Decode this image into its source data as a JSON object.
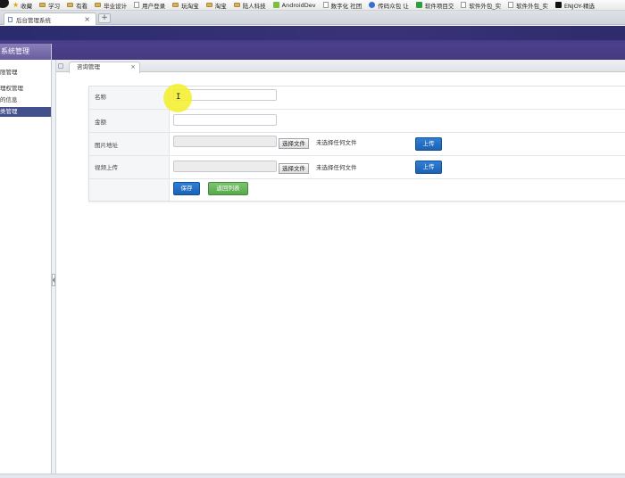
{
  "bookmarks": [
    {
      "label": "收藏",
      "icon": "star-icon"
    },
    {
      "label": "学习",
      "icon": "folder-icon"
    },
    {
      "label": "有看",
      "icon": "folder-icon"
    },
    {
      "label": "毕业设计",
      "icon": "folder-icon"
    },
    {
      "label": "用户登录",
      "icon": "doc-icon"
    },
    {
      "label": "玩淘宝",
      "icon": "folder-icon"
    },
    {
      "label": "淘宝",
      "icon": "folder-icon"
    },
    {
      "label": "陆人科技",
      "icon": "folder-icon"
    },
    {
      "label": "AndroidDev",
      "icon": "android-icon"
    },
    {
      "label": "数字化 社团",
      "icon": "doc-icon"
    },
    {
      "label": "传码众包 让",
      "icon": "circle-icon"
    },
    {
      "label": "软件项目交",
      "icon": "s-icon"
    },
    {
      "label": "软件外包_实",
      "icon": "doc-icon"
    },
    {
      "label": "软件外包_实",
      "icon": "doc-icon"
    },
    {
      "label": "ENJOY-精选",
      "icon": "e-icon"
    }
  ],
  "browser_tab": {
    "title": "后台管理系统",
    "close": "×",
    "new_tab": "+"
  },
  "sidebar": {
    "header": "系统管理",
    "items": [
      {
        "label": "限管理",
        "active": false
      },
      {
        "label": "理权管理",
        "active": false
      },
      {
        "label": "的信息",
        "active": false
      },
      {
        "label": "类管理",
        "active": true
      }
    ]
  },
  "content_tab": {
    "label": "咨询管理",
    "close": "×"
  },
  "form": {
    "rows": [
      {
        "label": "名称",
        "value": ""
      },
      {
        "label": "金额",
        "value": ""
      }
    ],
    "file_rows": [
      {
        "label": "图片地址",
        "choose": "选择文件",
        "status": "未选择任何文件",
        "upload": "上传"
      },
      {
        "label": "视频上传",
        "choose": "选择文件",
        "status": "未选择任何文件",
        "upload": "上传"
      }
    ],
    "save": "保存",
    "back": "返回列表"
  },
  "colors": {
    "banner": "#3d3580",
    "primary_button": "#1f6cc0",
    "back_button": "#5cae50",
    "sidebar_active": "#44508c",
    "cursor_highlight": "#f4ee28"
  }
}
